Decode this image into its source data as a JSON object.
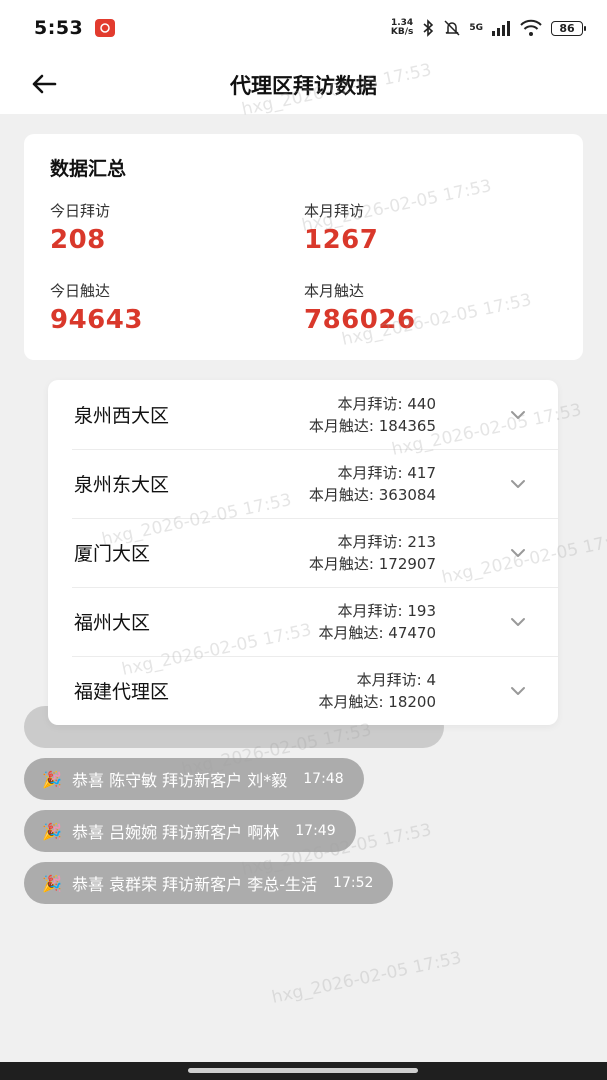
{
  "status_bar": {
    "time": "5:53",
    "speed_value": "1.34",
    "speed_unit": "KB/s",
    "network": "5G",
    "battery": "86"
  },
  "header": {
    "title": "代理区拜访数据"
  },
  "summary": {
    "title": "数据汇总",
    "today_visit_label": "今日拜访",
    "today_visit_value": "208",
    "month_visit_label": "本月拜访",
    "month_visit_value": "1267",
    "today_reach_label": "今日触达",
    "today_reach_value": "94643",
    "month_reach_label": "本月触达",
    "month_reach_value": "786026"
  },
  "regions": [
    {
      "name": "泉州西大区",
      "visits": "本月拜访: 440",
      "reach": "本月触达: 184365"
    },
    {
      "name": "泉州东大区",
      "visits": "本月拜访: 417",
      "reach": "本月触达: 363084"
    },
    {
      "name": "厦门大区",
      "visits": "本月拜访: 213",
      "reach": "本月触达: 172907"
    },
    {
      "name": "福州大区",
      "visits": "本月拜访: 193",
      "reach": "本月触达: 47470"
    },
    {
      "name": "福建代理区",
      "visits": "本月拜访: 4",
      "reach": "本月触达: 18200"
    }
  ],
  "notifications": [
    {
      "text": "恭喜 陈守敏 拜访新客户 刘*毅",
      "time": "17:48"
    },
    {
      "text": "恭喜 吕婉婉 拜访新客户 啊林",
      "time": "17:49"
    },
    {
      "text": "恭喜 袁群荣 拜访新客户 李总-生活",
      "time": "17:52"
    }
  ],
  "watermarks": [
    "hxg_2026-02-05 17:53"
  ]
}
